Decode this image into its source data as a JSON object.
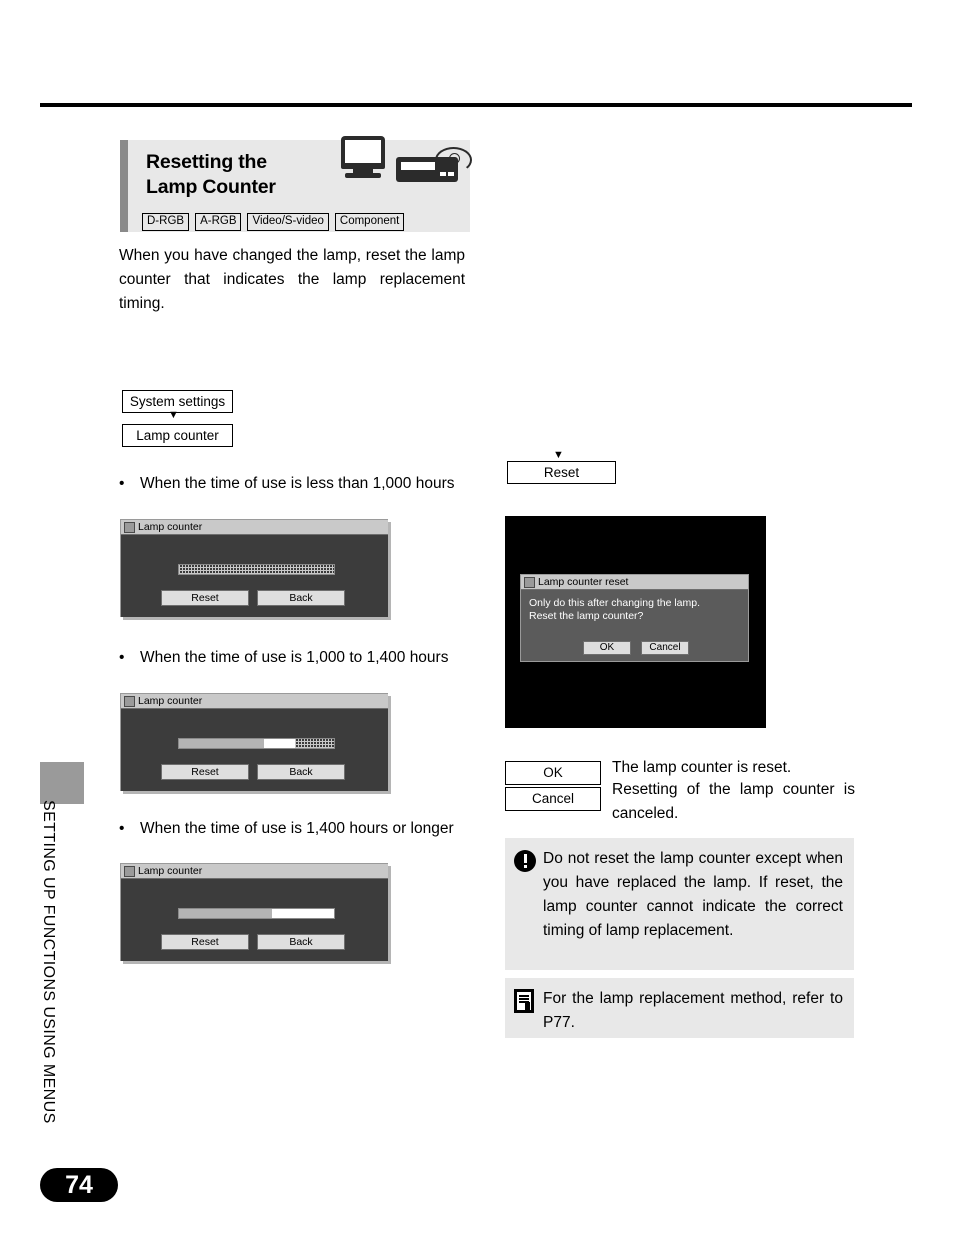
{
  "heading": {
    "title_line1": "Resetting the",
    "title_line2": "Lamp Counter",
    "badges": [
      "D-RGB",
      "A-RGB",
      "Video/S-video",
      "Component"
    ]
  },
  "intro": "When you have changed the lamp, reset the lamp counter that indicates the lamp replacement timing.",
  "menu_path": {
    "system_settings": "System settings",
    "arrow": "▼",
    "lamp_counter": "Lamp counter",
    "reset_arrow": "▼",
    "reset": "Reset"
  },
  "bullets": [
    {
      "dot": "•",
      "text": "When the time of use is less than 1,000 hours"
    },
    {
      "dot": "•",
      "text": "When the time of use is 1,000 to 1,400 hours"
    },
    {
      "dot": "•",
      "text": "When the time of use is 1,400 hours or longer"
    }
  ],
  "osd_screens": [
    {
      "title": "Lamp counter",
      "gauge": {
        "solid_pct": 0,
        "dots_pct": 100,
        "white_pct": 0
      },
      "buttons": [
        "Reset",
        "Back"
      ]
    },
    {
      "title": "Lamp counter",
      "gauge": {
        "solid_pct": 55,
        "dots_pct": 25,
        "white_pct": 20
      },
      "buttons": [
        "Reset",
        "Back"
      ]
    },
    {
      "title": "Lamp counter",
      "gauge": {
        "solid_pct": 60,
        "dots_pct": 0,
        "white_pct": 40
      },
      "buttons": [
        "Reset",
        "Back"
      ]
    }
  ],
  "dialog": {
    "title": "Lamp counter reset",
    "message_line1": "Only do this after changing the lamp.",
    "message_line2": "Reset the lamp counter?",
    "buttons": [
      "OK",
      "Cancel"
    ]
  },
  "legend": {
    "ok_label": "OK",
    "ok_text": "The lamp counter is reset.",
    "cancel_label": "Cancel",
    "cancel_text": "Resetting of the lamp counter is canceled."
  },
  "notices": {
    "warning": "Do not reset the lamp counter except when you have replaced the lamp. If reset, the lamp counter cannot indicate the correct timing of lamp replacement.",
    "reference": "For the lamp replacement method, refer to P77."
  },
  "chapter_label": "SETTING UP FUNCTIONS USING MENUS",
  "page_number": "74",
  "colors": {
    "heading_bg": "#e8e8e8",
    "heading_bar": "#8a8a8a",
    "notice_bg": "#e8e8e8",
    "osd_bg": "#3c3c3c",
    "page_badge": "#000000"
  }
}
